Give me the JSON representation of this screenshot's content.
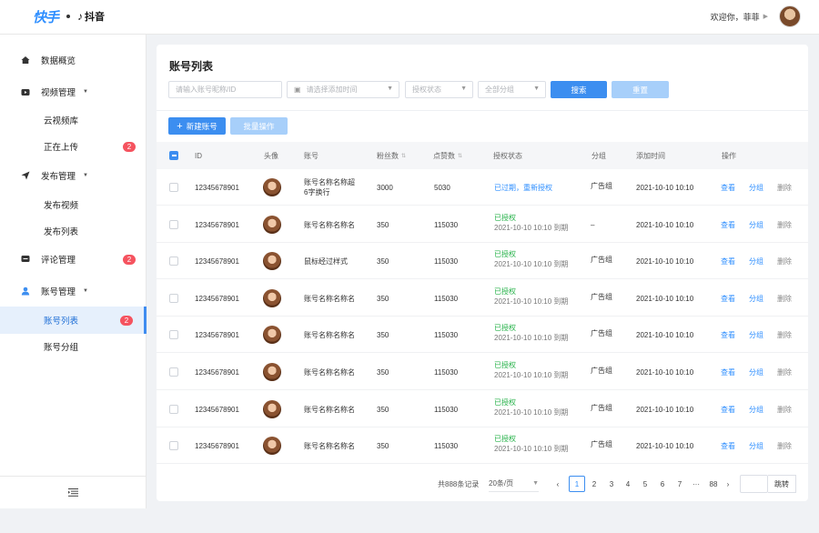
{
  "header": {
    "logo_text": "快手",
    "logo_sub": "抖音",
    "welcome": "欢迎你，菲菲"
  },
  "sidebar": {
    "items": [
      {
        "label": "数据概览",
        "icon": "home-icon"
      },
      {
        "label": "视频管理",
        "icon": "video-icon",
        "expanded": true
      },
      {
        "label": "云视频库"
      },
      {
        "label": "正在上传",
        "badge": "2"
      },
      {
        "label": "发布管理",
        "icon": "send-icon",
        "expanded": true
      },
      {
        "label": "发布视频"
      },
      {
        "label": "发布列表"
      },
      {
        "label": "评论管理",
        "icon": "comment-icon",
        "badge": "2"
      },
      {
        "label": "账号管理",
        "icon": "user-icon",
        "expanded": true
      },
      {
        "label": "账号列表",
        "badge": "2",
        "active": true
      },
      {
        "label": "账号分组"
      }
    ]
  },
  "page": {
    "title": "账号列表",
    "filters": {
      "account_placeholder": "请输入账号昵称/ID",
      "date_placeholder": "请选择添加时间",
      "auth_placeholder": "授权状态",
      "group_placeholder": "全部分组"
    },
    "search_label": "搜索",
    "reset_label": "重置",
    "new_label": "新建账号",
    "batch_label": "批量操作"
  },
  "table": {
    "columns": {
      "id": "ID",
      "avatar": "头像",
      "account": "账号",
      "fans": "粉丝数",
      "likes": "点赞数",
      "auth": "授权状态",
      "group": "分组",
      "added": "添加时间",
      "ops": "操作"
    },
    "rows": [
      {
        "id": "12345678901",
        "account": "账号名称名称超",
        "account2": "6字换行",
        "fans": "3000",
        "likes": "5030",
        "auth": "已过期，重新授权",
        "auth_sub": "",
        "group": "广告组",
        "added": "2021-10-10 10:10"
      },
      {
        "id": "12345678901",
        "account": "账号名称名称名",
        "account2": "",
        "fans": "350",
        "likes": "115030",
        "auth": "已授权",
        "auth_sub": "2021-10-10 10:10 到期",
        "group": "–",
        "added": "2021-10-10 10:10"
      },
      {
        "id": "12345678901",
        "account": "鼠标经过样式",
        "account2": "",
        "fans": "350",
        "likes": "115030",
        "auth": "已授权",
        "auth_sub": "2021-10-10 10:10 到期",
        "group": "广告组",
        "added": "2021-10-10 10:10"
      },
      {
        "id": "12345678901",
        "account": "账号名称名称名",
        "account2": "",
        "fans": "350",
        "likes": "115030",
        "auth": "已授权",
        "auth_sub": "2021-10-10 10:10 到期",
        "group": "广告组",
        "added": "2021-10-10 10:10"
      },
      {
        "id": "12345678901",
        "account": "账号名称名称名",
        "account2": "",
        "fans": "350",
        "likes": "115030",
        "auth": "已授权",
        "auth_sub": "2021-10-10 10:10 到期",
        "group": "广告组",
        "added": "2021-10-10 10:10"
      },
      {
        "id": "12345678901",
        "account": "账号名称名称名",
        "account2": "",
        "fans": "350",
        "likes": "115030",
        "auth": "已授权",
        "auth_sub": "2021-10-10 10:10 到期",
        "group": "广告组",
        "added": "2021-10-10 10:10"
      },
      {
        "id": "12345678901",
        "account": "账号名称名称名",
        "account2": "",
        "fans": "350",
        "likes": "115030",
        "auth": "已授权",
        "auth_sub": "2021-10-10 10:10 到期",
        "group": "广告组",
        "added": "2021-10-10 10:10"
      },
      {
        "id": "12345678901",
        "account": "账号名称名称名",
        "account2": "",
        "fans": "350",
        "likes": "115030",
        "auth": "已授权",
        "auth_sub": "2021-10-10 10:10 到期",
        "group": "广告组",
        "added": "2021-10-10 10:10"
      }
    ],
    "actions": {
      "view": "查看",
      "group": "分组",
      "delete": "删除"
    }
  },
  "pagination": {
    "total": "共888条记录",
    "page_size": "20条/页",
    "pages": [
      "1",
      "2",
      "3",
      "4",
      "5",
      "6",
      "7",
      "···",
      "88"
    ],
    "current": "1",
    "jump": "跳转"
  },
  "colors": {
    "primary": "#3c8ef0",
    "link": "#2f8fff",
    "success": "#27b24a",
    "badge": "#f5535f"
  }
}
